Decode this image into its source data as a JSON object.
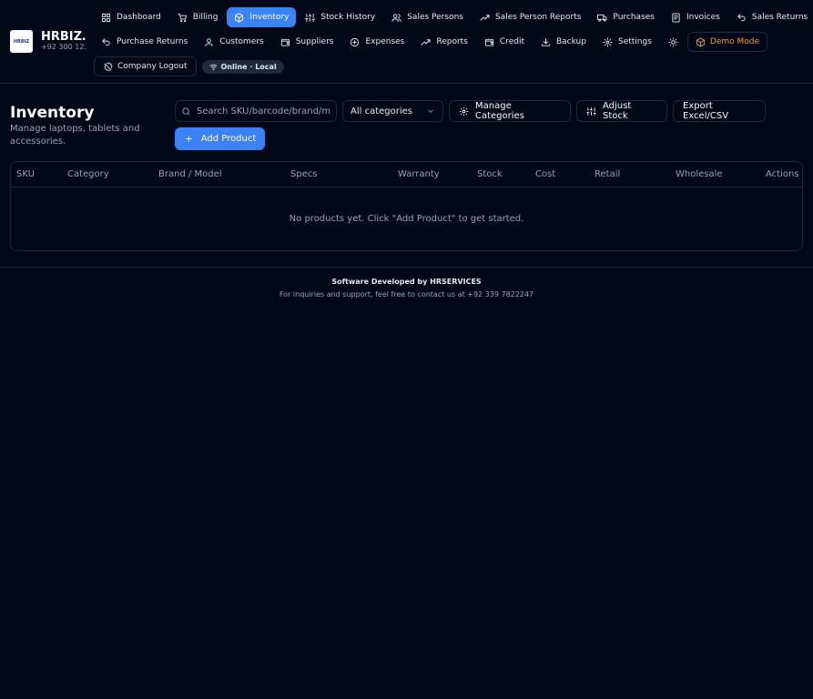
{
  "brand": {
    "name": "HRBIZ…",
    "phone": "+92 300 12…",
    "logo_text": "HRBIZ"
  },
  "nav": {
    "row1": [
      {
        "label": "Dashboard",
        "icon": "grid-icon"
      },
      {
        "label": "Billing",
        "icon": "cart-icon"
      },
      {
        "label": "Inventory",
        "icon": "box-icon",
        "active": true
      },
      {
        "label": "Stock History",
        "icon": "sliders-icon"
      },
      {
        "label": "Sales Persons",
        "icon": "users-icon"
      },
      {
        "label": "Sales Person Reports",
        "icon": "trending-up-icon"
      },
      {
        "label": "Purchases",
        "icon": "truck-icon"
      },
      {
        "label": "Invoices",
        "icon": "file-text-icon"
      },
      {
        "label": "Sales Returns",
        "icon": "undo-icon"
      }
    ],
    "row2": [
      {
        "label": "Purchase Returns",
        "icon": "undo-icon"
      },
      {
        "label": "Customers",
        "icon": "user-icon"
      },
      {
        "label": "Suppliers",
        "icon": "wallet-icon"
      },
      {
        "label": "Expenses",
        "icon": "circle-plus-icon"
      },
      {
        "label": "Reports",
        "icon": "trending-up-icon"
      },
      {
        "label": "Credit",
        "icon": "wallet-icon"
      },
      {
        "label": "Backup",
        "icon": "download-icon"
      },
      {
        "label": "Settings",
        "icon": "gear-icon"
      }
    ],
    "theme_icon": "sun-icon",
    "demo_mode_label": "Demo Mode",
    "logout_label": "Company Logout",
    "status_label": "Online · Local"
  },
  "page": {
    "title": "Inventory",
    "subtitle": "Manage laptops, tablets and accessories."
  },
  "toolbar": {
    "search_placeholder": "Search SKU/barcode/brand/model",
    "search_value": "",
    "category_selected": "All categories",
    "manage_label": "Manage Categories",
    "adjust_label": "Adjust Stock",
    "export_label": "Export Excel/CSV",
    "add_label": "Add Product"
  },
  "table": {
    "columns": [
      "SKU",
      "Category",
      "Brand / Model",
      "Specs",
      "Warranty",
      "Stock",
      "Cost",
      "Retail",
      "Wholesale",
      "Actions"
    ],
    "rows": [],
    "empty_message": "No products yet. Click \"Add Product\" to get started."
  },
  "footer": {
    "title": "Software Developed by HRSERVICES",
    "subtitle": "For inquiries and support, feel free to contact us at +92 339 7822247"
  },
  "colors": {
    "background": "#020817",
    "accent": "#3b82f6",
    "border": "#1e293b",
    "muted_text": "#94a3b8",
    "demo": "#f59e0b"
  }
}
